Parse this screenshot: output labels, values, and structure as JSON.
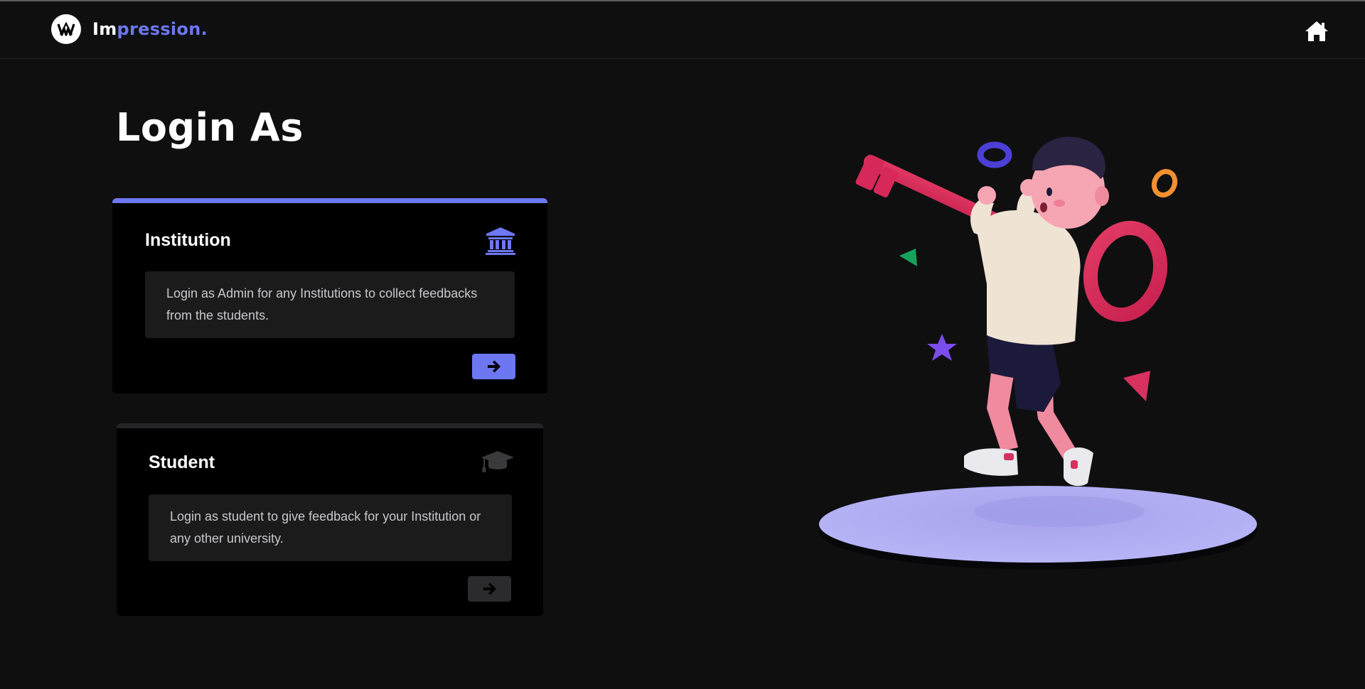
{
  "navbar": {
    "brand_prefix": "Im",
    "brand_suffix": "pression.",
    "logo_icon": "impression-logo-icon",
    "home_icon": "home-icon"
  },
  "main": {
    "heading": "Login As"
  },
  "cards": {
    "institution": {
      "title": "Institution",
      "description": "Login as Admin for any Institutions to collect feedbacks from the students.",
      "icon": "institution-icon",
      "accent": "#6d77f2",
      "button_icon": "arrow-right-icon"
    },
    "student": {
      "title": "Student",
      "description": "Login as student to give feedback for your Institution or any other university.",
      "icon": "graduation-cap-icon",
      "button_icon": "arrow-right-icon"
    }
  },
  "colors": {
    "background": "#0f0f10",
    "accent": "#6d77f2",
    "card": "#000000",
    "card_text_box": "#1b1b1c"
  },
  "illustration": {
    "subject": "3d-boy-carrying-key-illustration"
  }
}
